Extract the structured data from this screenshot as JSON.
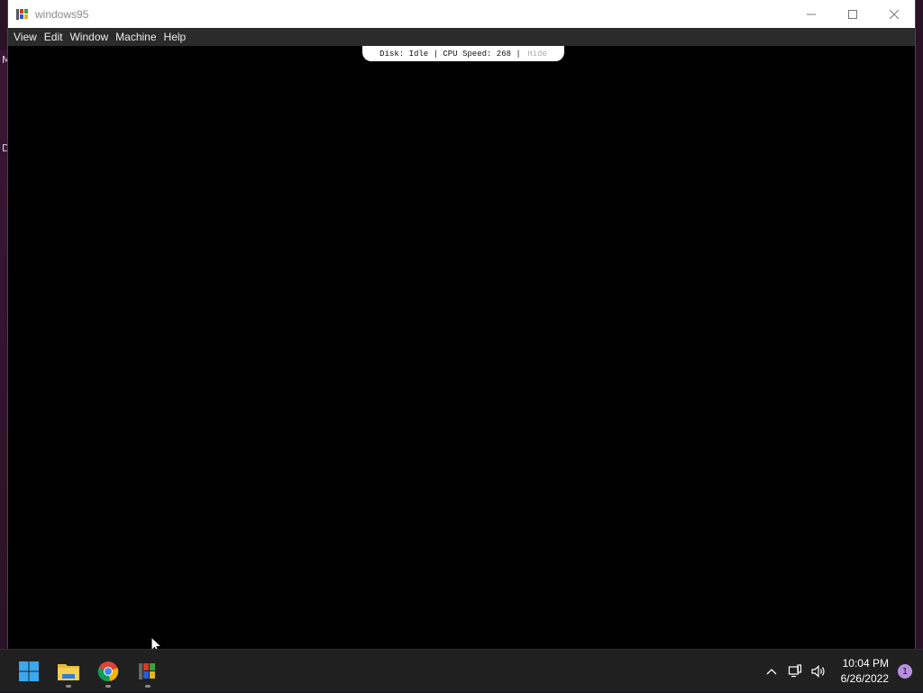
{
  "window": {
    "title": "windows95",
    "controls": {
      "minimize_icon": "minimize-icon",
      "maximize_icon": "maximize-icon",
      "close_icon": "close-icon"
    }
  },
  "menubar": {
    "items": [
      {
        "label": "View"
      },
      {
        "label": "Edit"
      },
      {
        "label": "Window"
      },
      {
        "label": "Machine"
      },
      {
        "label": "Help"
      }
    ]
  },
  "status": {
    "disk_text": "Disk: Idle | CPU Speed: 268 | ",
    "hide_label": "Hide"
  },
  "desktop_edge": {
    "glyph_top": "M",
    "glyph_mid": "D"
  },
  "taskbar": {
    "apps": [
      {
        "name": "start-icon"
      },
      {
        "name": "file-explorer-icon"
      },
      {
        "name": "chrome-icon"
      },
      {
        "name": "windows95-app-icon"
      }
    ],
    "clock": {
      "time": "10:04 PM",
      "date": "6/26/2022"
    },
    "notification_count": "1"
  },
  "colors": {
    "taskbar_bg": "#202020",
    "menubar_bg": "#2b2b2b",
    "screen_bg": "#000000",
    "notif_badge": "#b88ee0"
  }
}
